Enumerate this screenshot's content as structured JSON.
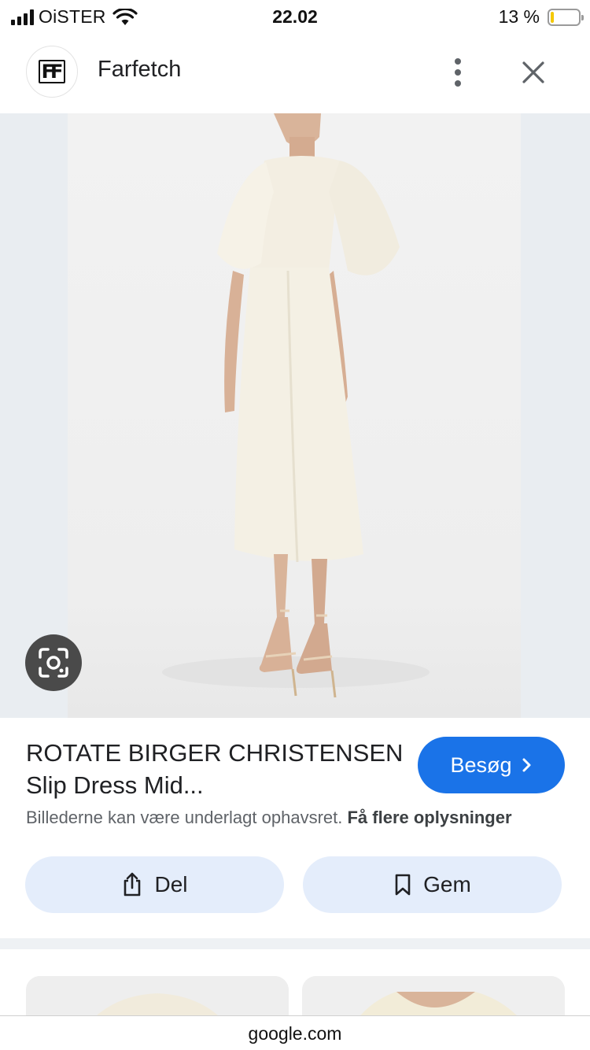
{
  "status_bar": {
    "carrier": "OiSTER",
    "time": "22.02",
    "battery_percent": "13 %",
    "battery_level": 0.13
  },
  "header": {
    "site_logo_text": "FF",
    "site_name": "Farfetch",
    "icons": {
      "menu": "more-vert-icon",
      "close": "close-icon"
    }
  },
  "image": {
    "description_icon": "google-lens-icon"
  },
  "result": {
    "title": "ROTATE BIRGER CHRISTENSEN Slip Dress Mid...",
    "visit_label": "Besøg",
    "copyright_text": "Billederne kan være underlagt ophavsret.",
    "more_info_link": "Få flere oplysninger",
    "share_label": "Del",
    "save_label": "Gem"
  },
  "url_bar": {
    "domain": "google.com"
  },
  "colors": {
    "accent": "#1a73e8",
    "action_bg": "#e4edfb",
    "image_bg": "#e9edf1"
  }
}
